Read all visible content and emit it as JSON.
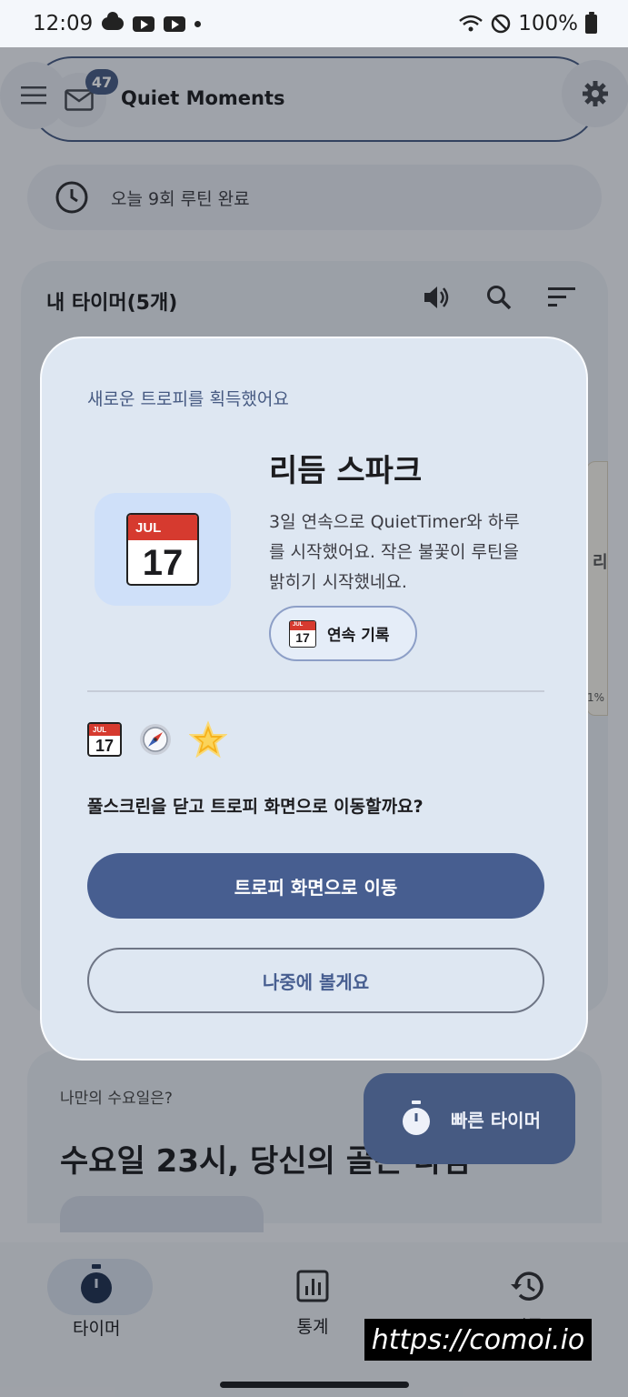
{
  "status_bar": {
    "time": "12:09",
    "battery": "100%"
  },
  "app_bar": {
    "title": "Quiet Moments",
    "mail_count": "47"
  },
  "routine": {
    "text": "오늘 9회 루틴 완료"
  },
  "timer_card": {
    "title": "내 타이머(5개)",
    "peek_text": "리",
    "peek_percent": "1%"
  },
  "insight": {
    "question": "나만의 수요일은?",
    "headline": "수요일 23시, 당신의 골든 타임"
  },
  "fab": {
    "label": "빠른 타이머"
  },
  "bottom_nav": {
    "items": [
      {
        "label": "타이머",
        "icon": "stopwatch-icon"
      },
      {
        "label": "통계",
        "icon": "bar-chart-icon"
      },
      {
        "label": "기록",
        "icon": "history-icon"
      }
    ]
  },
  "dialog": {
    "overline": "새로운 트로피를 획득했어요",
    "trophy_name": "리듬 스파크",
    "trophy_description": "3일 연속으로 QuietTimer와 하루를 시작했어요. 작은 불꽃이 루틴을 밝히기 시작했네요.",
    "streak_chip": "연속 기록",
    "calendar_month": "JUL",
    "calendar_day": "17",
    "question": "풀스크린을 닫고 트로피 화면으로 이동할까요?",
    "primary_button": "트로피 화면으로 이동",
    "secondary_button": "나중에 볼게요"
  },
  "watermark": "https://comoi.io",
  "colors": {
    "accent": "#475e90",
    "dialog_bg": "#dee7f2",
    "tile_bg": "#cfe0f9",
    "calendar_red": "#d63a2f"
  }
}
